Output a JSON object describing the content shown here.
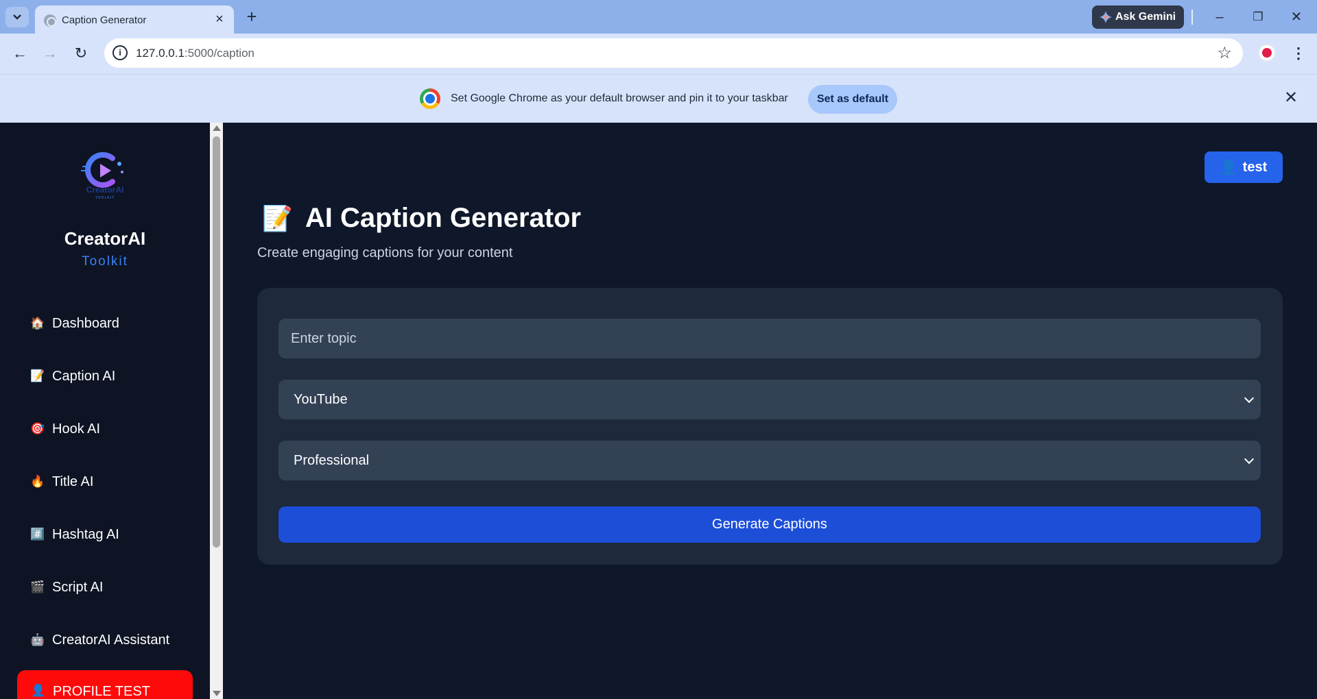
{
  "browser": {
    "tab_title": "Caption Generator",
    "url_host": "127.0.0.1",
    "url_path": ":5000/caption",
    "gemini_label": "Ask Gemini",
    "infobar_text": "Set Google Chrome as your default browser and pin it to your taskbar",
    "set_default_label": "Set as default"
  },
  "sidebar": {
    "brand": "CreatorAI",
    "brand_sub": "Toolkit",
    "logo_text": "CreatorAI",
    "logo_subtext": "TOOLKIT",
    "items": [
      {
        "emoji": "🏠",
        "label": "Dashboard"
      },
      {
        "emoji": "📝",
        "label": "Caption AI"
      },
      {
        "emoji": "🎯",
        "label": "Hook AI"
      },
      {
        "emoji": "🔥",
        "label": "Title AI"
      },
      {
        "emoji": "#️⃣",
        "label": "Hashtag AI"
      },
      {
        "emoji": "🎬",
        "label": "Script AI"
      },
      {
        "emoji": "🤖",
        "label": "CreatorAI Assistant"
      }
    ],
    "profile_button": {
      "emoji": "👤",
      "label": "PROFILE TEST"
    }
  },
  "header": {
    "user_emoji": "👤",
    "user_label": "test"
  },
  "main": {
    "title_emoji": "📝",
    "title": "AI Caption Generator",
    "subtitle": "Create engaging captions for your content",
    "topic_placeholder": "Enter topic",
    "platform_selected": "YouTube",
    "tone_selected": "Professional",
    "generate_label": "Generate Captions"
  },
  "colors": {
    "accent": "#2563eb",
    "generate_button": "#1d4ed8",
    "profile_button": "#ff0a0a",
    "background": "#0f172a",
    "sidebar": "#0e1424",
    "card": "#1e293b",
    "field": "#334155"
  }
}
